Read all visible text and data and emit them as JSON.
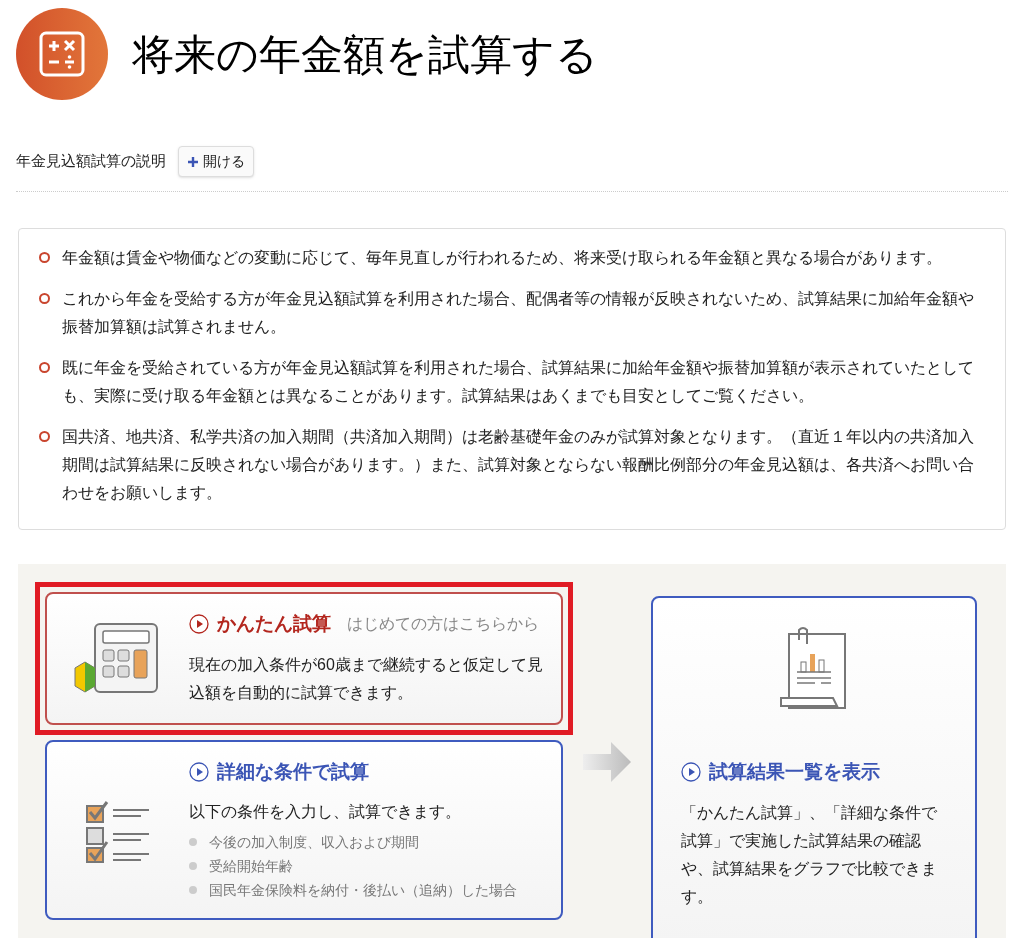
{
  "header": {
    "title": "将来の年金額を試算する"
  },
  "explanation": {
    "label": "年金見込額試算の説明",
    "toggle_button": "開ける"
  },
  "notices": [
    "年金額は賃金や物価などの変動に応じて、毎年見直しが行われるため、将来受け取られる年金額と異なる場合があります。",
    "これから年金を受給する方が年金見込額試算を利用された場合、配偶者等の情報が反映されないため、試算結果に加給年金額や振替加算額は試算されません。",
    "既に年金を受給されている方が年金見込額試算を利用された場合、試算結果に加給年金額や振替加算額が表示されていたとしても、実際に受け取る年金額とは異なることがあります。試算結果はあくまでも目安としてご覧ください。",
    "国共済、地共済、私学共済の加入期間（共済加入期間）は老齢基礎年金のみが試算対象となります。（直近１年以内の共済加入期間は試算結果に反映されない場合があります。）また、試算対象とならない報酬比例部分の年金見込額は、各共済へお問い合わせをお願いします。"
  ],
  "cards": [
    {
      "kind": "quick",
      "title": "かんたん試算",
      "subtitle": "はじめての方はこちらから",
      "description": "現在の加入条件が60歳まで継続すると仮定して見込額を自動的に試算できます。",
      "highlighted": true
    },
    {
      "kind": "detailed",
      "title": "詳細な条件で試算",
      "description": "以下の条件を入力し、試算できます。",
      "bullets": [
        "今後の加入制度、収入および期間",
        "受給開始年齢",
        "国民年金保険料を納付・後払い（追納）した場合"
      ],
      "highlighted": false
    },
    {
      "kind": "results",
      "title": "試算結果一覧を表示",
      "description": "「かんたん試算」、「詳細な条件で試算」で実施した試算結果の確認や、試算結果をグラフで比較できます。",
      "highlighted": false
    }
  ]
}
